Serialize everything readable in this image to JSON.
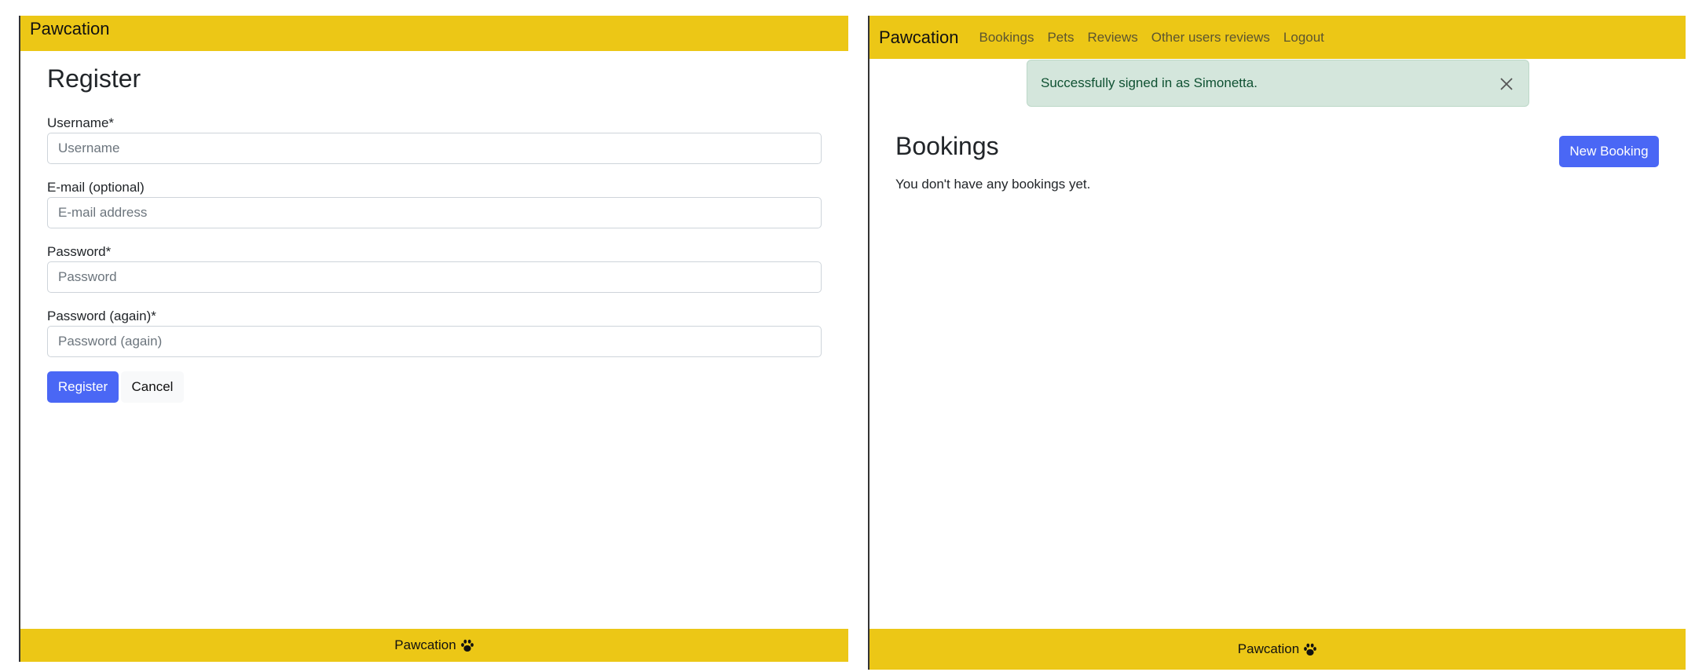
{
  "register_screen": {
    "navbar": {
      "brand": "Pawcation"
    },
    "title": "Register",
    "fields": {
      "username": {
        "label": "Username*",
        "placeholder": "Username"
      },
      "email": {
        "label": "E-mail (optional)",
        "placeholder": "E-mail address"
      },
      "password": {
        "label": "Password*",
        "placeholder": "Password"
      },
      "password_again": {
        "label": "Password (again)*",
        "placeholder": "Password (again)"
      }
    },
    "buttons": {
      "register": "Register",
      "cancel": "Cancel"
    },
    "footer": {
      "text": "Pawcation",
      "icon": "paw-icon"
    }
  },
  "bookings_screen": {
    "navbar": {
      "brand": "Pawcation",
      "links": [
        "Bookings",
        "Pets",
        "Reviews",
        "Other users reviews",
        "Logout"
      ]
    },
    "alert": {
      "text": "Successfully signed in as Simonetta.",
      "close_icon": "close-icon"
    },
    "title": "Bookings",
    "new_booking_button": "New Booking",
    "empty_message": "You don't have any bookings yet.",
    "footer": {
      "text": "Pawcation",
      "icon": "paw-icon"
    }
  },
  "colors": {
    "navbar": "#ecc716",
    "primary_button": "#4a67f5",
    "alert_background": "#d4e6dc",
    "alert_text": "#0f5132",
    "nav_link": "#5c5530"
  }
}
